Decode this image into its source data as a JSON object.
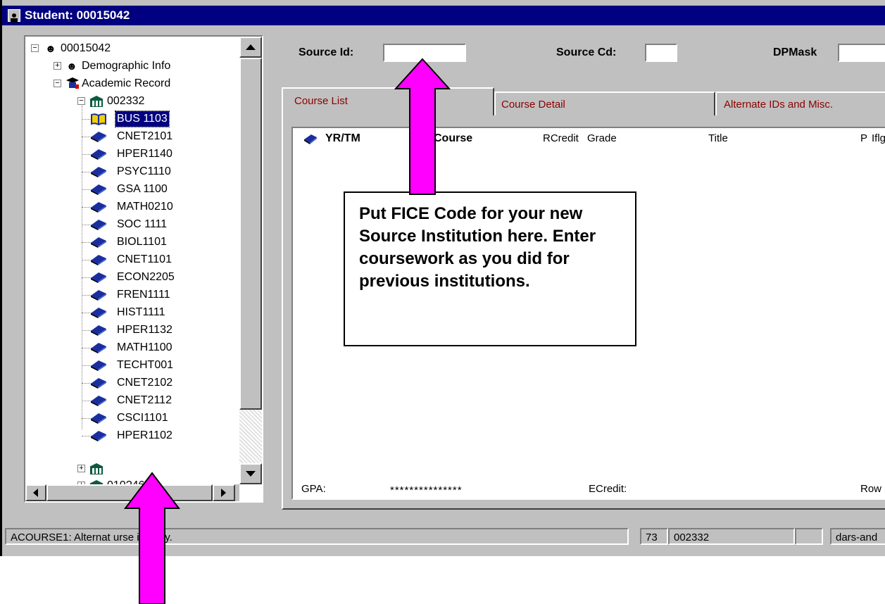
{
  "window": {
    "title": "Student: 00015042"
  },
  "tree": {
    "root": "00015042",
    "demographic": "Demographic Info",
    "academic": "Academic Record",
    "institution1": "002332",
    "courses": [
      "BUS 1103",
      "CNET2101",
      "HPER1140",
      "PSYC1110",
      "GSA 1100",
      "MATH0210",
      "SOC 1111",
      "BIOL1101",
      "CNET1101",
      "ECON2205",
      "FREN1111",
      "HIST1111",
      "HPER1132",
      "MATH1100",
      "TECHT001",
      "CNET2102",
      "CNET2112",
      "CSCI1101",
      "HPER1102"
    ],
    "selected_course": "BUS 1103",
    "institution3": "010?46"
  },
  "fields": {
    "source_id_label": "Source Id:",
    "source_id_value": "",
    "source_cd_label": "Source Cd:",
    "source_cd_value": "",
    "dpmask_label": "DPMask",
    "dpmask_value": ""
  },
  "tabs": [
    "Course List",
    "Course Detail",
    "Alternate IDs and Misc."
  ],
  "list": {
    "columns": [
      "YR/TM",
      "Course",
      "RCredit",
      "Grade",
      "Title",
      "P",
      "Iflg"
    ],
    "gpa_label": "GPA:",
    "gpa_value": "***************",
    "ecredit_label": "ECredit:",
    "row_label": "Row"
  },
  "callout": "Put FICE Code for your new Source Institution here.  Enter coursework as you did for previous institutions.",
  "status": {
    "message": "ACOURSE1: Alternat     urse identity.",
    "count": "73",
    "inst": "002332",
    "blank": "",
    "user": "dars-and"
  },
  "colors": {
    "title_bar": "#000080",
    "arrow": "#ff00ff",
    "tab_text": "#8b0000",
    "book": "#1a2ea0"
  }
}
